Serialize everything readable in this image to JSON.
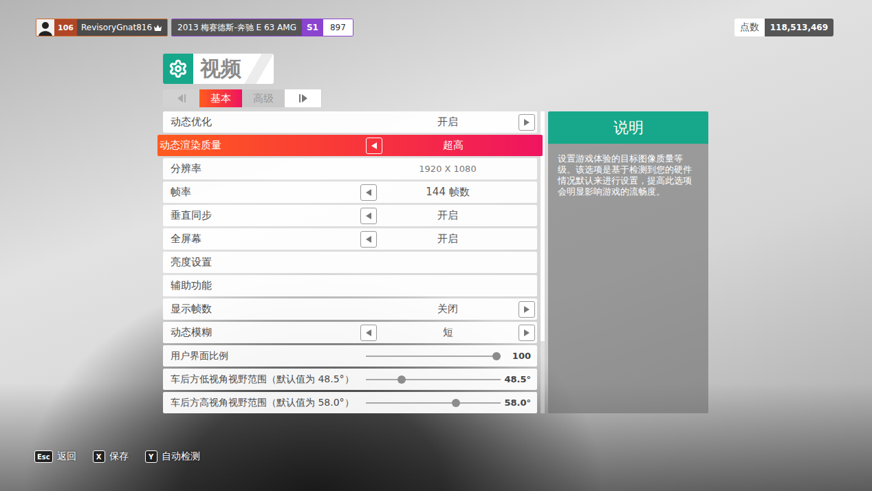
{
  "profile": {
    "level": "106",
    "name": "RevisoryGnat816"
  },
  "car": {
    "name": "2013 梅赛德斯-奔驰 E 63 AMG",
    "class": "S1",
    "rating": "897"
  },
  "points": {
    "label": "点数",
    "value": "118,513,469"
  },
  "page": {
    "title": "视频"
  },
  "tabs": [
    {
      "label": "基本",
      "selected": true
    },
    {
      "label": "高级",
      "selected": false
    }
  ],
  "settings": [
    {
      "kind": "option",
      "label": "动态优化",
      "value": "开启",
      "left": false,
      "right": true,
      "selected": false,
      "disabled": false
    },
    {
      "kind": "option",
      "label": "动态渲染质量",
      "value": "超高",
      "left": true,
      "right": false,
      "selected": true,
      "disabled": false
    },
    {
      "kind": "option",
      "label": "分辨率",
      "value": "1920 X 1080",
      "left": false,
      "right": false,
      "selected": false,
      "disabled": true
    },
    {
      "kind": "option",
      "label": "帧率",
      "value": "144 帧数",
      "left": true,
      "right": false,
      "selected": false,
      "disabled": false
    },
    {
      "kind": "option",
      "label": "垂直同步",
      "value": "开启",
      "left": true,
      "right": false,
      "selected": false,
      "disabled": false
    },
    {
      "kind": "option",
      "label": "全屏幕",
      "value": "开启",
      "left": true,
      "right": false,
      "selected": false,
      "disabled": false
    },
    {
      "kind": "link",
      "label": "亮度设置",
      "selected": false,
      "disabled": false
    },
    {
      "kind": "link",
      "label": "辅助功能",
      "selected": false,
      "disabled": false
    },
    {
      "kind": "option",
      "label": "显示帧数",
      "value": "关闭",
      "left": false,
      "right": true,
      "selected": false,
      "disabled": false
    },
    {
      "kind": "option",
      "label": "动态模糊",
      "value": "短",
      "left": true,
      "right": true,
      "selected": false,
      "disabled": false
    },
    {
      "kind": "slider",
      "label": "用户界面比例",
      "value": "100",
      "level": 1.0,
      "selected": false,
      "disabled": false
    },
    {
      "kind": "slider",
      "label": "车后方低视角视野范围（默认值为 48.5°）",
      "value": "48.5°",
      "level": 0.25,
      "selected": false,
      "disabled": false
    },
    {
      "kind": "slider",
      "label": "车后方高视角视野范围（默认值为 58.0°）",
      "value": "58.0°",
      "level": 0.68,
      "selected": false,
      "disabled": false
    }
  ],
  "scrollbar": {
    "level": 0.76
  },
  "description": {
    "title": "说明",
    "text": "设置游戏体验的目标图像质量等级。该选项是基于检测到您的硬件情况默认来进行设置，提高此选项会明显影响游戏的流畅度。"
  },
  "hints": [
    {
      "key": "Esc",
      "label": "返回"
    },
    {
      "key": "X",
      "label": "保存"
    },
    {
      "key": "Y",
      "label": "自动检测"
    }
  ]
}
